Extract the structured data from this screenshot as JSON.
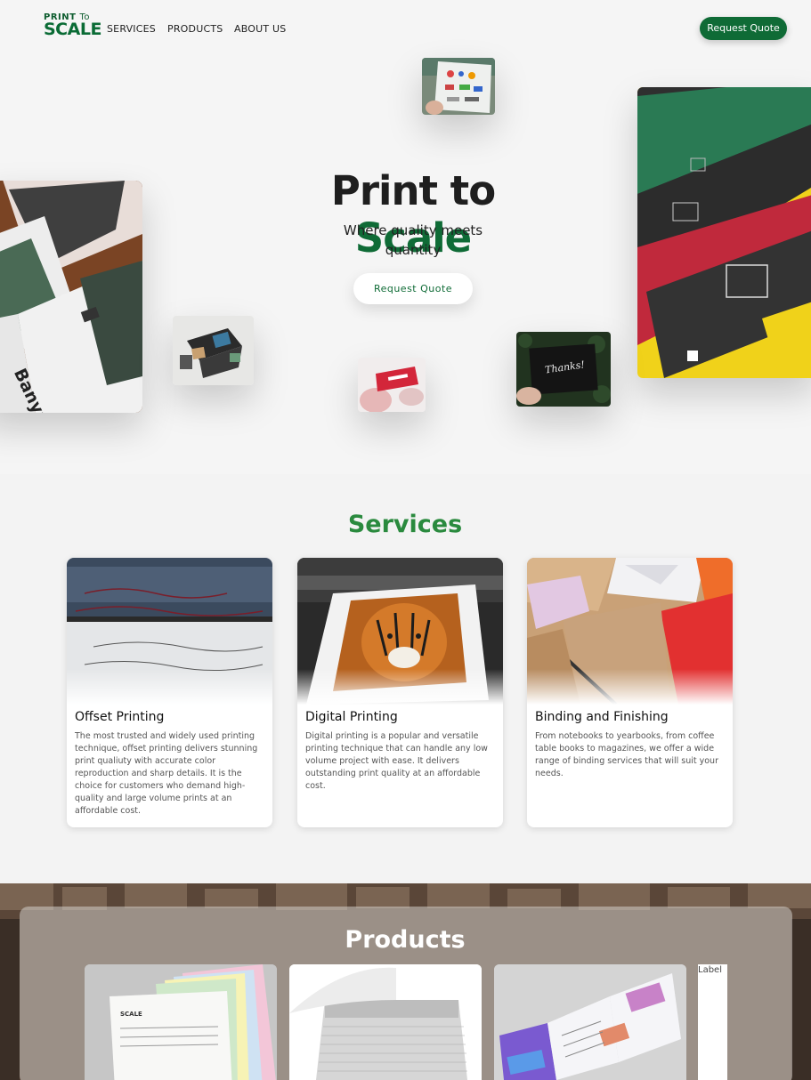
{
  "brand": {
    "logo_top": "PRINT",
    "logo_to": "To",
    "logo_main": "SCALE",
    "accent": "#0f6b36"
  },
  "nav": {
    "links": [
      "SERVICES",
      "PRODUCTS",
      "ABOUT US"
    ],
    "cta": "Request Quote"
  },
  "hero": {
    "title_part1": "Print to",
    "title_part2": "Scale",
    "subtitle": "Where quality meets quantity",
    "cta": "Request Quote",
    "book_cover_text": "Banyan",
    "card_text": "Thanks!"
  },
  "services": {
    "heading": "Services",
    "items": [
      {
        "title": "Offset Printing",
        "description": "The most trusted and widely used printing technique, offset printing delivers stunning print qualiuty with accurate color reproduction and sharp details. It is the choice for customers who demand high-quality and large volume prints at an affordable cost."
      },
      {
        "title": "Digital Printing",
        "description": "Digital printing is a popular and versatile printing technique that can handle any low volume project with ease. It delivers outstanding print quality at an affordable cost."
      },
      {
        "title": "Binding and Finishing",
        "description": "From notebooks to yearbooks, from coffee table books to magazines, we offer a wide range of binding services that will suit your needs."
      }
    ]
  },
  "products": {
    "heading": "Products",
    "broken_image_alt": "Label"
  }
}
